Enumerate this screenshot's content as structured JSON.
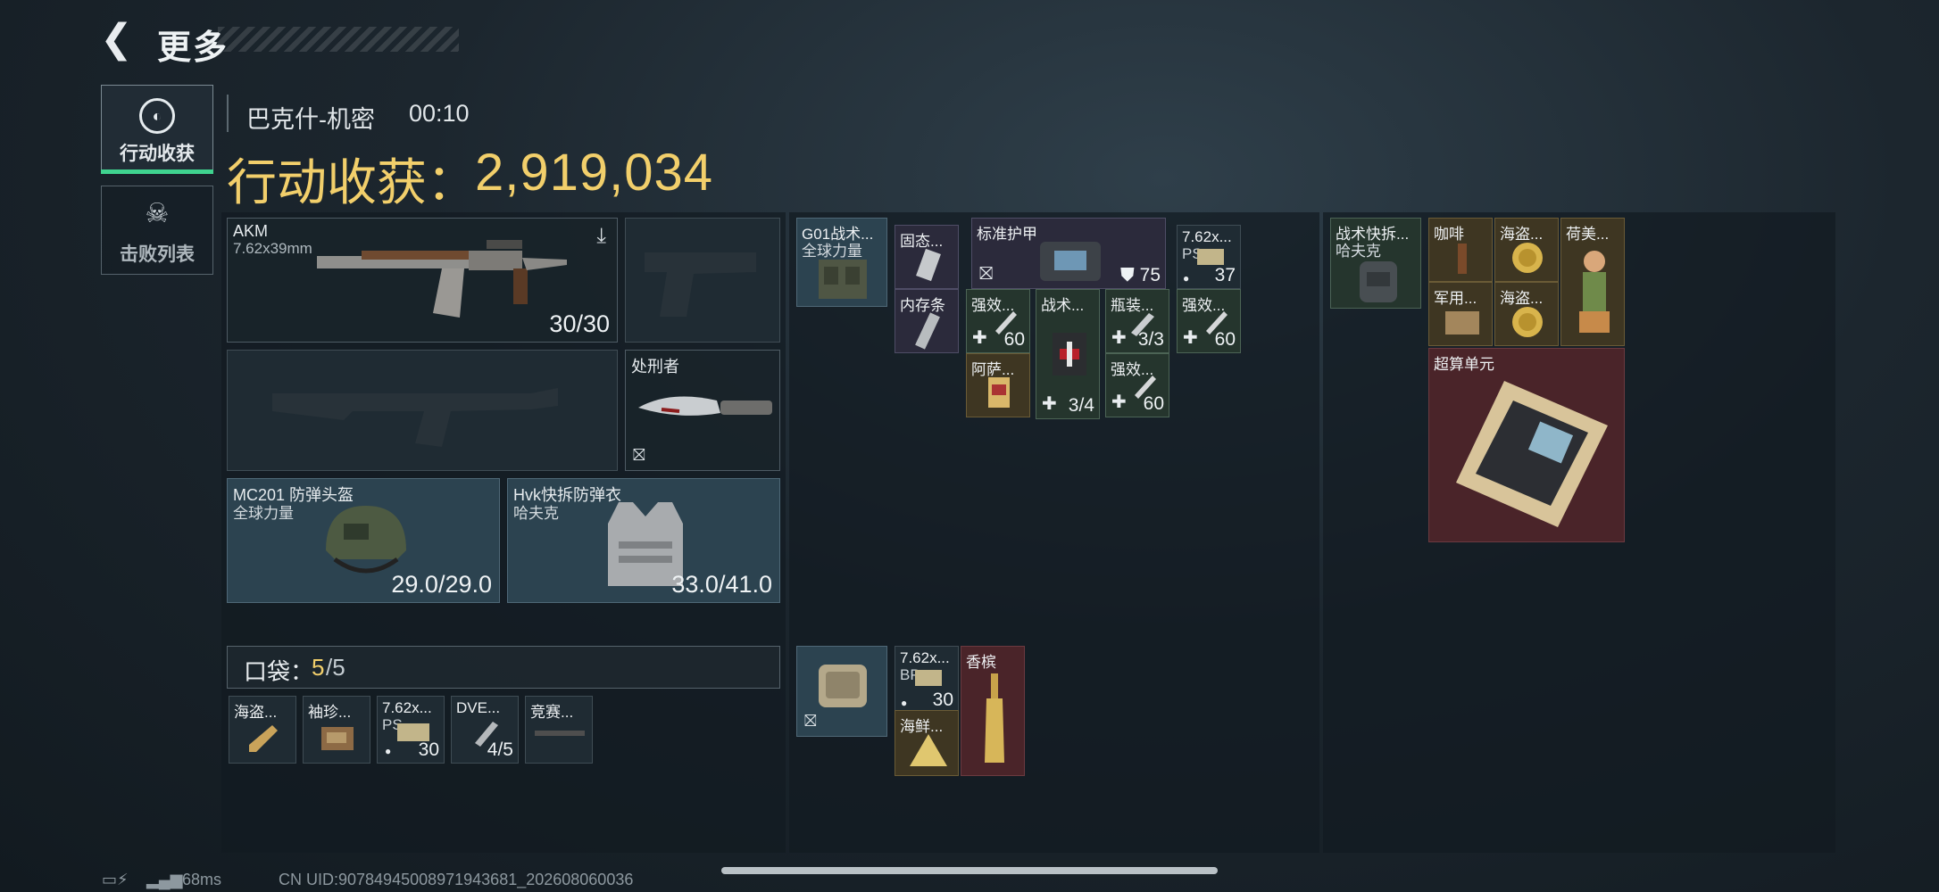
{
  "header": {
    "back_icon": "chevron-left-icon",
    "title": "更多"
  },
  "tabs": [
    {
      "label": "行动收获",
      "icon": "coin-icon",
      "active": true
    },
    {
      "label": "击败列表",
      "icon": "skull-icon",
      "active": false
    }
  ],
  "match": {
    "map": "巴克什-机密",
    "time": "00:10",
    "loot_label": "行动收获：",
    "loot_value": "2,919,034"
  },
  "loadout": {
    "primary": {
      "name": "AKM",
      "ammo": "7.62x39mm",
      "count": "30/30"
    },
    "melee": {
      "name": "处刑者"
    },
    "helmet": {
      "name": "MC201 防弹头盔",
      "brand": "全球力量",
      "durability": "29.0/29.0"
    },
    "armor": {
      "name": "Hvk快拆防弹衣",
      "brand": "哈夫克",
      "durability": "33.0/41.0"
    },
    "pocket": {
      "label": "口袋：",
      "count": "5",
      "max": "/5"
    },
    "pocket_items": [
      {
        "name": "海盗...",
        "value": ""
      },
      {
        "name": "袖珍...",
        "value": ""
      },
      {
        "name": "7.62x...",
        "sub": "PS",
        "value": "30"
      },
      {
        "name": "DVE...",
        "value": "4/5"
      },
      {
        "name": "竞赛...",
        "value": ""
      }
    ]
  },
  "rig": {
    "chest": {
      "name": "G01战术...",
      "brand": "全球力量"
    },
    "items": [
      {
        "name": "固态..."
      },
      {
        "name": "内存条"
      },
      {
        "name": "标准护甲",
        "value": "75"
      },
      {
        "name": "7.62x...",
        "sub": "PS",
        "value": "37"
      },
      {
        "name": "强效...",
        "value": "60"
      },
      {
        "name": "战术...",
        "value": "3/4"
      },
      {
        "name": "瓶装...",
        "value": "3/3"
      },
      {
        "name": "强效...",
        "value": "60"
      },
      {
        "name": "阿萨..."
      },
      {
        "name": "强效...",
        "value": "60"
      }
    ],
    "pouch_items": [
      {
        "name": "7.62x...",
        "sub": "BP",
        "value": "30"
      },
      {
        "name": "香槟"
      },
      {
        "name": "海鲜..."
      }
    ]
  },
  "backpack": {
    "bag": {
      "name": "战术快拆...",
      "brand": "哈夫克"
    },
    "items": [
      {
        "name": "咖啡"
      },
      {
        "name": "海盗..."
      },
      {
        "name": "荷美..."
      },
      {
        "name": "军用..."
      },
      {
        "name": "海盗..."
      },
      {
        "name": "超算单元"
      }
    ]
  },
  "footer": {
    "ping": "68ms",
    "uid": "CN UID:907849450089719436​81_202608060036"
  },
  "colors": {
    "gold": "#f2cf6b",
    "accent_green": "#3fd38f",
    "rarity_red": "#4a2429",
    "rarity_blue": "#2c4350"
  }
}
